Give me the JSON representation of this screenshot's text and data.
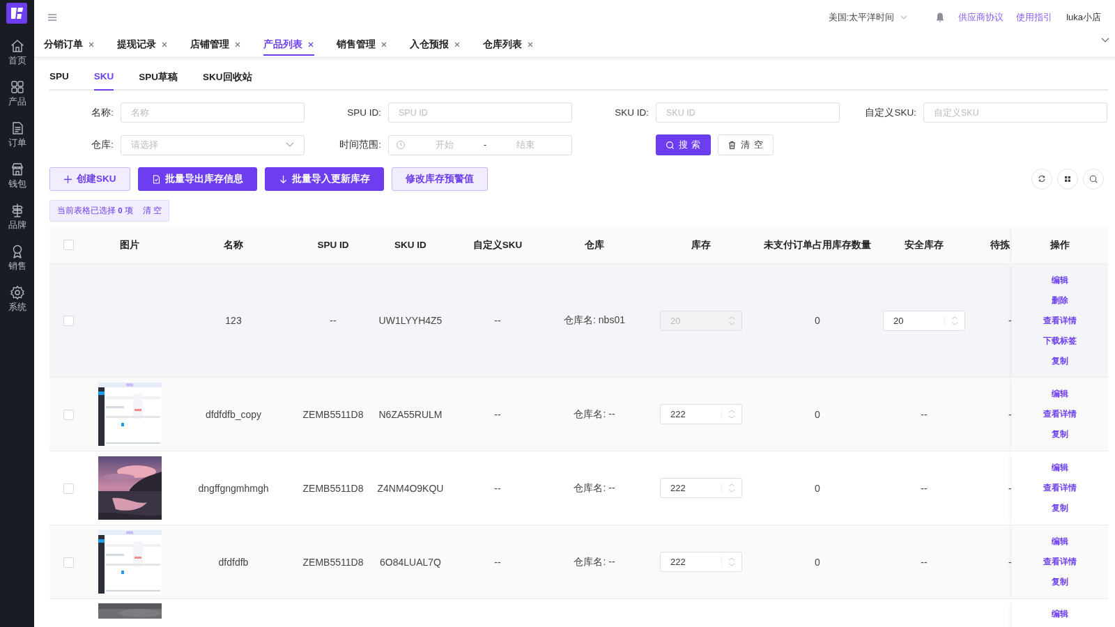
{
  "sidebar": {
    "items": [
      {
        "label": "首页",
        "kind": "home"
      },
      {
        "label": "产品",
        "kind": "grid"
      },
      {
        "label": "订单",
        "kind": "doc"
      },
      {
        "label": "钱包",
        "kind": "store"
      },
      {
        "label": "品牌",
        "kind": "sign"
      },
      {
        "label": "销售",
        "kind": "badge"
      },
      {
        "label": "系统",
        "kind": "gear"
      }
    ]
  },
  "header": {
    "timezone": "美国:太平洋时间",
    "links": [
      "供应商协议",
      "使用指引"
    ],
    "user": "luka小店"
  },
  "tabs": [
    {
      "label": "分销订单",
      "selected": false
    },
    {
      "label": "提现记录",
      "selected": false
    },
    {
      "label": "店铺管理",
      "selected": false
    },
    {
      "label": "产品列表",
      "selected": true
    },
    {
      "label": "销售管理",
      "selected": false
    },
    {
      "label": "入仓预报",
      "selected": false
    },
    {
      "label": "仓库列表",
      "selected": false
    }
  ],
  "subtabs": [
    {
      "label": "SPU",
      "selected": false
    },
    {
      "label": "SKU",
      "selected": true
    },
    {
      "label": "SPU草稿",
      "selected": false
    },
    {
      "label": "SKU回收站",
      "selected": false
    }
  ],
  "filters": [
    {
      "label": "名称:",
      "kind": "text",
      "placeholder": "名称"
    },
    {
      "label": "SPU ID:",
      "kind": "text",
      "placeholder": "SPU ID"
    },
    {
      "label": "SKU ID:",
      "kind": "text",
      "placeholder": "SKU ID"
    },
    {
      "label": "自定义SKU:",
      "kind": "text",
      "placeholder": "自定义SKU"
    },
    {
      "label": "仓库:",
      "kind": "select",
      "placeholder": "请选择"
    },
    {
      "label": "时间范围:",
      "kind": "daterange",
      "start_placeholder": "开始",
      "separator": "-",
      "end_placeholder": "结束"
    }
  ],
  "filter_buttons": [
    {
      "label": "搜 索",
      "kind": "primary"
    },
    {
      "label": "清 空",
      "kind": "default"
    }
  ],
  "actions": [
    {
      "label": "创建SKU",
      "kind": "light"
    },
    {
      "label": "批量导出库存信息",
      "kind": "primary"
    },
    {
      "label": "批量导入更新库存",
      "kind": "primary"
    },
    {
      "label": "修改库存预警值",
      "kind": "light"
    }
  ],
  "tools": [
    {
      "kind": "refresh"
    },
    {
      "kind": "grid"
    },
    {
      "kind": "search"
    }
  ],
  "selection": {
    "text": "当前表格已选择 **0** 项",
    "clear": "清 空"
  },
  "table": {
    "select_all_checked": false,
    "columns": [
      "图片",
      "名称",
      "SPU ID",
      "SKU ID",
      "自定义SKU",
      "仓库",
      "库存",
      "未支付订单占用库存数量",
      "安全库存",
      "待拣",
      "操作"
    ],
    "rows": [
      {
        "checked": false,
        "hovered": true,
        "name": "123",
        "spu_id": "--",
        "sku_id": "UW1LYYH4Z5",
        "custom_sku": "--",
        "warehouse": "仓库名: nbs01",
        "stock": {
          "value": "20",
          "disabled": true
        },
        "unpaid": "0",
        "safe_stock": {
          "kind": "input",
          "value": "20"
        },
        "pick": "-",
        "actions": [
          "编辑",
          "删除",
          "查看详情",
          "下载标签",
          "复制"
        ]
      },
      {
        "checked": false,
        "hovered": false,
        "image": {
          "kind": "picture"
        },
        "name": "dfdfdfb_copy",
        "spu_id": "ZEMB5511D8",
        "sku_id": "N6ZA55RULM",
        "custom_sku": "--",
        "warehouse": "仓库名: --",
        "stock": {
          "value": "222",
          "disabled": false
        },
        "unpaid": "0",
        "safe_stock": {
          "kind": "text",
          "value": "--"
        },
        "pick": "-",
        "actions": [
          "编辑",
          "查看详情",
          "复制"
        ]
      },
      {
        "checked": false,
        "hovered": false,
        "image": {
          "kind": "picture"
        },
        "name": "dngffgngmhmgh",
        "spu_id": "ZEMB5511D8",
        "sku_id": "Z4NM4O9KQU",
        "custom_sku": "--",
        "warehouse": "仓库名: --",
        "stock": {
          "value": "222",
          "disabled": false
        },
        "unpaid": "0",
        "safe_stock": {
          "kind": "text",
          "value": "--"
        },
        "pick": "-",
        "actions": [
          "编辑",
          "查看详情",
          "复制"
        ]
      },
      {
        "checked": false,
        "hovered": false,
        "image": {
          "kind": "picture"
        },
        "name": "dfdfdfb",
        "spu_id": "ZEMB5511D8",
        "sku_id": "6O84LUAL7Q",
        "custom_sku": "--",
        "warehouse": "仓库名: --",
        "stock": {
          "value": "222",
          "disabled": false
        },
        "unpaid": "0",
        "safe_stock": {
          "kind": "text",
          "value": "--"
        },
        "pick": "-",
        "actions": [
          "编辑",
          "查看详情",
          "复制"
        ]
      },
      {
        "hovered": false,
        "image": {
          "kind": "picture"
        },
        "actions": [
          "编辑"
        ]
      }
    ]
  }
}
